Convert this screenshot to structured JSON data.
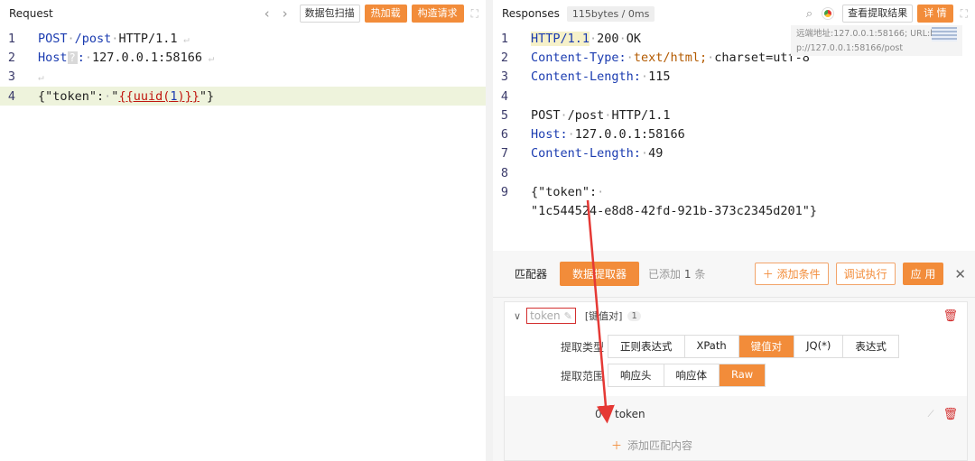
{
  "request": {
    "title": "Request",
    "nav_prev": "‹",
    "nav_next": "›",
    "btn_scan": "数据包扫描",
    "btn_hot": "热加载",
    "btn_build": "构造请求",
    "lines": [
      {
        "n": "1",
        "method": "POST",
        "path": "/post",
        "proto": "HTTP/1.1"
      },
      {
        "n": "2",
        "key": "Host",
        "q": "?",
        "value": "127.0.0.1:58166"
      },
      {
        "n": "3"
      },
      {
        "n": "4",
        "open": "{\"token\":",
        "quote_open": "\"",
        "tpl_a": "{{uuid(",
        "tpl_n": "1",
        "tpl_b": ")}}",
        "close": "\"}"
      }
    ]
  },
  "response": {
    "title": "Responses",
    "size_badge": "115bytes / 0ms",
    "btn_view": "查看提取结果",
    "btn_detail": "详 情",
    "tooltip_line1": "远端地址:127.0.0.1:58166; URL:htt",
    "tooltip_line2": "p://127.0.0.1:58166/post",
    "lines": [
      {
        "n": "1",
        "a": "HTTP/1.1",
        "b": "200",
        "c": "OK"
      },
      {
        "n": "2",
        "key": "Content-Type:",
        "value": "text/html;",
        "extra": "charset=utf-8"
      },
      {
        "n": "3",
        "key": "Content-Length:",
        "value": "115"
      },
      {
        "n": "4"
      },
      {
        "n": "5",
        "a": "POST",
        "b": "/post",
        "c": "HTTP/1.1"
      },
      {
        "n": "6",
        "key": "Host:",
        "value": "127.0.0.1:58166"
      },
      {
        "n": "7",
        "key": "Content-Length:",
        "value": "49"
      },
      {
        "n": "8"
      },
      {
        "n": "9",
        "value": "{\"token\":"
      },
      {
        "n": "",
        "value": "\"1c544524-e8d8-42fd-921b-373c2345d201\"}"
      }
    ]
  },
  "extractor": {
    "tab_matcher": "匹配器",
    "tab_extractor": "数据提取器",
    "added_prefix": "已添加",
    "added_count": "1",
    "added_suffix": "条",
    "btn_add_cond": "添加条件",
    "btn_debug": "调试执行",
    "btn_apply": "应 用",
    "rule": {
      "name": "token",
      "type": "[键值对]",
      "count": "1",
      "label_type": "提取类型",
      "types": [
        "正则表达式",
        "XPath",
        "键值对",
        "JQ(*)",
        "表达式"
      ],
      "active_type": "键值对",
      "label_scope": "提取范围",
      "scopes": [
        "响应头",
        "响应体",
        "Raw"
      ],
      "active_scope": "Raw",
      "kv_index": "0",
      "kv_value": "token",
      "add_match": "添加匹配内容"
    }
  },
  "colors": {
    "accent": "#f28c3a",
    "keyword": "#1a3bb0",
    "template": "#c0170f",
    "annotation_arrow": "#e53935"
  }
}
